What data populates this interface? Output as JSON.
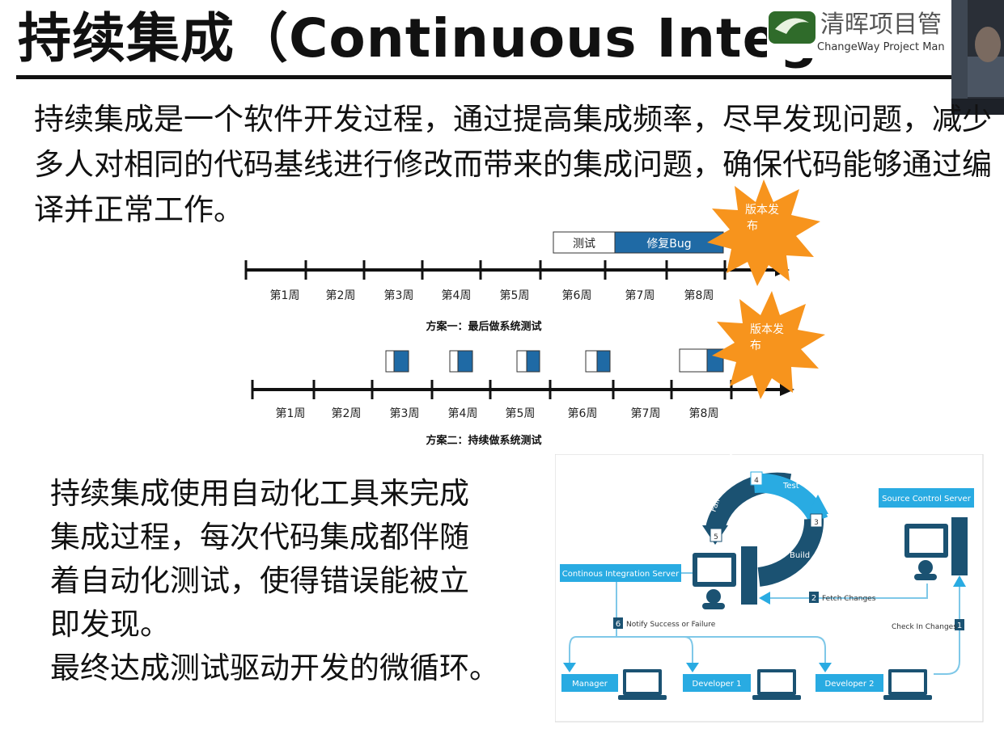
{
  "slide": {
    "title": "持续集成（Continuous Integratio",
    "logo_text_top": "清晖项目管",
    "logo_text_bottom": "ChangeWay Project Man",
    "intro_paragraph": "持续集成是一个软件开发过程，通过提高集成频率，尽早发现问题，减少多人对相同的代码基线进行修改而带来的集成问题，确保代码能够通过编译并正常工作。",
    "ci_paragraph_lines": [
      "持续集成使用自动化工具来完成",
      "集成过程，每次代码集成都伴随",
      "着自动化测试，使得错误能被立",
      "即发现。",
      "最终达成测试驱动开发的微循环。"
    ]
  },
  "timeline": {
    "weeks": [
      "第1周",
      "第2周",
      "第3周",
      "第4周",
      "第5周",
      "第6周",
      "第7周",
      "第8周"
    ],
    "plan1": {
      "caption": "方案一：最后做系统测试",
      "test_label": "测试",
      "fix_label": "修复Bug",
      "release_label_line1": "版本发",
      "release_label_line2": "布"
    },
    "plan2": {
      "caption": "方案二：持续做系统测试",
      "release_label_line1": "版本发",
      "release_label_line2": "布"
    },
    "colors": {
      "fix": "#1f6aa5",
      "burst": "#f7941d",
      "axis": "#111111"
    }
  },
  "ci_diagram": {
    "source_server": "Source Control Server",
    "ci_server": "Continous Integration Server",
    "step1": "1",
    "step1_label": "Check In Changes",
    "step2": "2",
    "step2_label": "Fetch Changes",
    "step3": "3",
    "step3_label": "Build",
    "step4": "4",
    "step4_label": "Test",
    "step5": "5",
    "step5_label": "Fail or Succeed",
    "step6": "6",
    "step6_label": "Notify Success or Failure",
    "manager": "Manager",
    "developer1": "Developer 1",
    "developer2": "Developer 2",
    "colors": {
      "accent": "#29abe2",
      "dark": "#1b5272",
      "line": "#7fc8e8"
    }
  }
}
